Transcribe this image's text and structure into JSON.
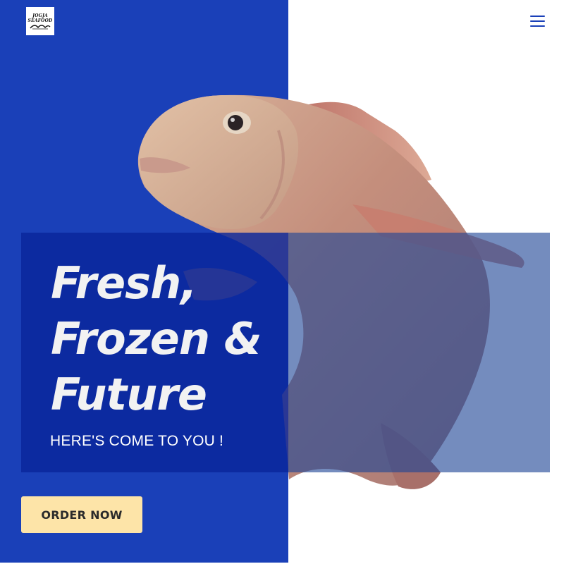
{
  "header": {
    "logo": {
      "line1": "JOGJA",
      "line2": "SEAFOOD"
    },
    "menu_icon": "hamburger-menu-icon"
  },
  "hero": {
    "title_lines": [
      "Fresh,",
      "Frozen &",
      "Future"
    ],
    "subtitle": "HERE'S COME TO YOU !",
    "cta_label": "ORDER NOW"
  },
  "colors": {
    "brand_blue": "#1a40b8",
    "cta_background": "#fde4a8",
    "text_light": "#f2f2f2"
  }
}
